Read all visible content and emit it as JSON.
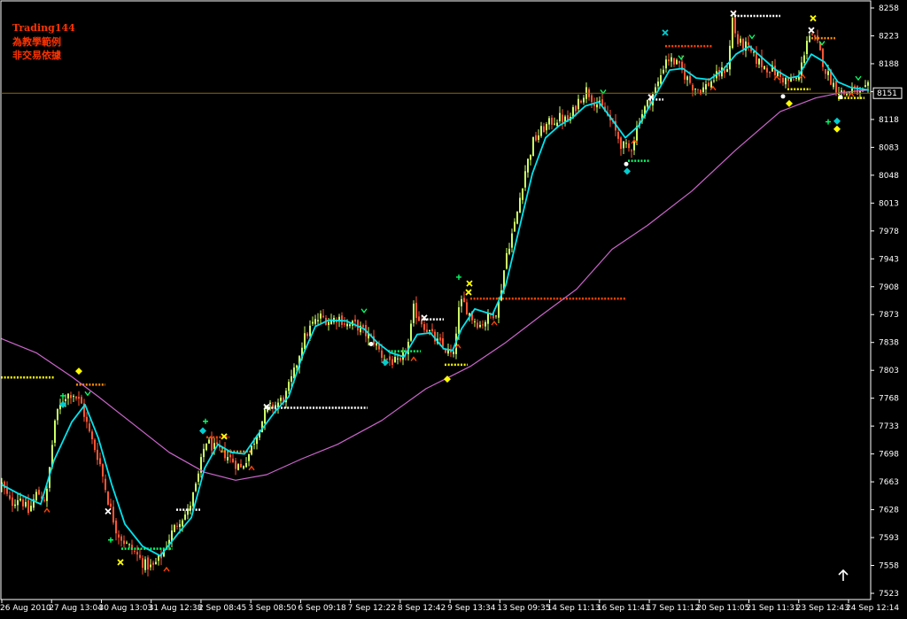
{
  "chart_data": {
    "type": "candlestick",
    "watermark": [
      "Trading144",
      "為教學範例",
      "非交易依據"
    ],
    "current_price": "8151",
    "ylim": [
      7505,
      8270
    ],
    "y_ticks": [
      "8258",
      "8223",
      "8188",
      "8153",
      "8118",
      "8083",
      "8048",
      "8013",
      "7978",
      "7943",
      "7908",
      "7873",
      "7838",
      "7803",
      "7768",
      "7733",
      "7698",
      "7663",
      "7628",
      "7593",
      "7558",
      "7523"
    ],
    "x_ticks": [
      "26 Aug 2010",
      "27 Aug 13:04",
      "30 Aug 13:03",
      "31 Aug 12:38",
      "2 Sep 08:45",
      "3 Sep 08:50",
      "6 Sep 09:18",
      "7 Sep 12:22",
      "8 Sep 12:42",
      "9 Sep 13:34",
      "13 Sep 09:35",
      "14 Sep 11:13",
      "16 Sep 11:41",
      "17 Sep 11:12",
      "20 Sep 11:05",
      "21 Sep 11:31",
      "23 Sep 12:43",
      "24 Sep 12:14"
    ],
    "price_path": [
      [
        0,
        7660
      ],
      [
        10,
        7635
      ],
      [
        20,
        7645
      ],
      [
        30,
        7625
      ],
      [
        40,
        7650
      ],
      [
        50,
        7640
      ],
      [
        60,
        7740
      ],
      [
        70,
        7770
      ],
      [
        80,
        7775
      ],
      [
        90,
        7760
      ],
      [
        100,
        7720
      ],
      [
        110,
        7690
      ],
      [
        120,
        7640
      ],
      [
        130,
        7600
      ],
      [
        140,
        7585
      ],
      [
        150,
        7575
      ],
      [
        160,
        7560
      ],
      [
        170,
        7555
      ],
      [
        180,
        7570
      ],
      [
        190,
        7595
      ],
      [
        200,
        7615
      ],
      [
        210,
        7625
      ],
      [
        220,
        7660
      ],
      [
        230,
        7715
      ],
      [
        240,
        7705
      ],
      [
        250,
        7700
      ],
      [
        260,
        7690
      ],
      [
        270,
        7680
      ],
      [
        280,
        7700
      ],
      [
        290,
        7730
      ],
      [
        300,
        7755
      ],
      [
        310,
        7760
      ],
      [
        320,
        7770
      ],
      [
        330,
        7800
      ],
      [
        340,
        7840
      ],
      [
        350,
        7860
      ],
      [
        360,
        7870
      ],
      [
        370,
        7865
      ],
      [
        380,
        7870
      ],
      [
        390,
        7860
      ],
      [
        400,
        7860
      ],
      [
        410,
        7850
      ],
      [
        420,
        7840
      ],
      [
        430,
        7820
      ],
      [
        440,
        7815
      ],
      [
        450,
        7810
      ],
      [
        460,
        7840
      ],
      [
        465,
        7880
      ],
      [
        470,
        7870
      ],
      [
        480,
        7855
      ],
      [
        490,
        7840
      ],
      [
        500,
        7830
      ],
      [
        510,
        7820
      ],
      [
        515,
        7875
      ],
      [
        520,
        7890
      ],
      [
        530,
        7870
      ],
      [
        540,
        7860
      ],
      [
        550,
        7870
      ],
      [
        560,
        7880
      ],
      [
        570,
        7950
      ],
      [
        580,
        7990
      ],
      [
        590,
        8050
      ],
      [
        600,
        8090
      ],
      [
        610,
        8105
      ],
      [
        620,
        8115
      ],
      [
        630,
        8120
      ],
      [
        640,
        8115
      ],
      [
        650,
        8140
      ],
      [
        660,
        8155
      ],
      [
        670,
        8140
      ],
      [
        680,
        8130
      ],
      [
        690,
        8110
      ],
      [
        700,
        8085
      ],
      [
        710,
        8080
      ],
      [
        720,
        8120
      ],
      [
        730,
        8140
      ],
      [
        740,
        8160
      ],
      [
        750,
        8195
      ],
      [
        760,
        8190
      ],
      [
        770,
        8175
      ],
      [
        780,
        8160
      ],
      [
        790,
        8155
      ],
      [
        800,
        8165
      ],
      [
        810,
        8175
      ],
      [
        820,
        8185
      ],
      [
        825,
        8245
      ],
      [
        830,
        8215
      ],
      [
        840,
        8210
      ],
      [
        850,
        8195
      ],
      [
        860,
        8185
      ],
      [
        870,
        8180
      ],
      [
        880,
        8170
      ],
      [
        890,
        8165
      ],
      [
        900,
        8170
      ],
      [
        910,
        8225
      ],
      [
        920,
        8215
      ],
      [
        930,
        8180
      ],
      [
        940,
        8160
      ],
      [
        950,
        8150
      ],
      [
        960,
        8155
      ],
      [
        970,
        8150
      ],
      [
        980,
        8160
      ]
    ],
    "ema_fast": [
      [
        0,
        7660
      ],
      [
        20,
        7648
      ],
      [
        45,
        7635
      ],
      [
        60,
        7690
      ],
      [
        80,
        7738
      ],
      [
        95,
        7760
      ],
      [
        110,
        7718
      ],
      [
        125,
        7660
      ],
      [
        140,
        7610
      ],
      [
        160,
        7582
      ],
      [
        180,
        7570
      ],
      [
        200,
        7598
      ],
      [
        215,
        7618
      ],
      [
        230,
        7680
      ],
      [
        245,
        7710
      ],
      [
        260,
        7700
      ],
      [
        275,
        7698
      ],
      [
        290,
        7722
      ],
      [
        310,
        7752
      ],
      [
        325,
        7770
      ],
      [
        340,
        7820
      ],
      [
        355,
        7858
      ],
      [
        370,
        7866
      ],
      [
        390,
        7865
      ],
      [
        410,
        7855
      ],
      [
        425,
        7838
      ],
      [
        440,
        7825
      ],
      [
        455,
        7820
      ],
      [
        470,
        7848
      ],
      [
        485,
        7850
      ],
      [
        500,
        7830
      ],
      [
        510,
        7828
      ],
      [
        520,
        7855
      ],
      [
        535,
        7880
      ],
      [
        555,
        7873
      ],
      [
        570,
        7910
      ],
      [
        585,
        7980
      ],
      [
        600,
        8050
      ],
      [
        615,
        8095
      ],
      [
        630,
        8110
      ],
      [
        645,
        8120
      ],
      [
        660,
        8135
      ],
      [
        675,
        8140
      ],
      [
        690,
        8118
      ],
      [
        705,
        8095
      ],
      [
        720,
        8110
      ],
      [
        740,
        8150
      ],
      [
        755,
        8180
      ],
      [
        770,
        8182
      ],
      [
        785,
        8170
      ],
      [
        800,
        8168
      ],
      [
        815,
        8180
      ],
      [
        830,
        8200
      ],
      [
        845,
        8210
      ],
      [
        860,
        8195
      ],
      [
        875,
        8180
      ],
      [
        890,
        8170
      ],
      [
        900,
        8172
      ],
      [
        915,
        8200
      ],
      [
        930,
        8190
      ],
      [
        945,
        8165
      ],
      [
        960,
        8158
      ],
      [
        980,
        8155
      ]
    ],
    "ema_slow": [
      [
        0,
        7843
      ],
      [
        40,
        7825
      ],
      [
        80,
        7795
      ],
      [
        110,
        7770
      ],
      [
        150,
        7735
      ],
      [
        190,
        7700
      ],
      [
        230,
        7675
      ],
      [
        265,
        7665
      ],
      [
        300,
        7672
      ],
      [
        340,
        7692
      ],
      [
        380,
        7710
      ],
      [
        430,
        7740
      ],
      [
        480,
        7780
      ],
      [
        530,
        7808
      ],
      [
        570,
        7838
      ],
      [
        610,
        7872
      ],
      [
        650,
        7905
      ],
      [
        690,
        7955
      ],
      [
        730,
        7985
      ],
      [
        780,
        8028
      ],
      [
        830,
        8080
      ],
      [
        880,
        8128
      ],
      [
        920,
        8145
      ],
      [
        950,
        8152
      ],
      [
        980,
        8155
      ]
    ],
    "levels": [
      {
        "color": "#ffff00",
        "x": [
          0,
          60
        ],
        "y": 7794
      },
      {
        "color": "#ff8c00",
        "x": [
          85,
          118
        ],
        "y": 7785
      },
      {
        "color": "#ffffff",
        "x": [
          298,
          414
        ],
        "y": 7756
      },
      {
        "color": "#ff8c00",
        "x": [
          248,
          282
        ],
        "y": 7701
      },
      {
        "color": "#ff4500",
        "x": [
          232,
          258
        ],
        "y": 7719
      },
      {
        "color": "#ffffff",
        "x": [
          198,
          225
        ],
        "y": 7628
      },
      {
        "color": "#00ff66",
        "x": [
          136,
          194
        ],
        "y": 7579
      },
      {
        "color": "#00ff66",
        "x": [
          437,
          474
        ],
        "y": 7827
      },
      {
        "color": "#ffff00",
        "x": [
          501,
          527
        ],
        "y": 7810
      },
      {
        "color": "#ff4500",
        "x": [
          530,
          705
        ],
        "y": 7893
      },
      {
        "color": "#ffffff",
        "x": [
          477,
          500
        ],
        "y": 7867
      },
      {
        "color": "#00ff66",
        "x": [
          708,
          732
        ],
        "y": 8066
      },
      {
        "color": "#ff4500",
        "x": [
          750,
          803
        ],
        "y": 8210
      },
      {
        "color": "#ffffff",
        "x": [
          828,
          880
        ],
        "y": 8248
      },
      {
        "color": "#ff8c00",
        "x": [
          915,
          942
        ],
        "y": 8220
      },
      {
        "color": "#ffff00",
        "x": [
          888,
          914
        ],
        "y": 8156
      },
      {
        "color": "#ffff00",
        "x": [
          945,
          975
        ],
        "y": 8145
      },
      {
        "color": "#ffffff",
        "x": [
          732,
          748
        ],
        "y": 8143
      }
    ],
    "markers": [
      {
        "sym": "diamond",
        "color": "#ffff00",
        "x": 88,
        "y": 7802
      },
      {
        "sym": "diamond",
        "color": "#00ced1",
        "x": 70,
        "y": 7760
      },
      {
        "sym": "plus",
        "color": "#00ff66",
        "x": 70,
        "y": 7771
      },
      {
        "sym": "v",
        "color": "#00ff66",
        "x": 98,
        "y": 7774
      },
      {
        "sym": "caret",
        "color": "#ff4500",
        "x": 52,
        "y": 7627
      },
      {
        "sym": "x",
        "color": "#ffffff",
        "x": 121,
        "y": 7626
      },
      {
        "sym": "plus",
        "color": "#00ff66",
        "x": 124,
        "y": 7590
      },
      {
        "sym": "x",
        "color": "#ffff00",
        "x": 135,
        "y": 7562
      },
      {
        "sym": "caret",
        "color": "#ff4500",
        "x": 187,
        "y": 7553
      },
      {
        "sym": "plus",
        "color": "#00ff66",
        "x": 231,
        "y": 7739
      },
      {
        "sym": "diamond",
        "color": "#00ced1",
        "x": 228,
        "y": 7727
      },
      {
        "sym": "x",
        "color": "#ffff00",
        "x": 252,
        "y": 7720
      },
      {
        "sym": "caret",
        "color": "#ff4500",
        "x": 283,
        "y": 7680
      },
      {
        "sym": "x",
        "color": "#ffffff",
        "x": 300,
        "y": 7757
      },
      {
        "sym": "v",
        "color": "#00ff66",
        "x": 410,
        "y": 7878
      },
      {
        "sym": "dot",
        "color": "#ffffff",
        "x": 418,
        "y": 7836
      },
      {
        "sym": "diamond",
        "color": "#00ced1",
        "x": 434,
        "y": 7813
      },
      {
        "sym": "caret",
        "color": "#ff4500",
        "x": 466,
        "y": 7817
      },
      {
        "sym": "x",
        "color": "#ffffff",
        "x": 478,
        "y": 7869
      },
      {
        "sym": "diamond",
        "color": "#ffff00",
        "x": 504,
        "y": 7792
      },
      {
        "sym": "caret",
        "color": "#ff4500",
        "x": 516,
        "y": 7833
      },
      {
        "sym": "plus",
        "color": "#00ff66",
        "x": 517,
        "y": 7920
      },
      {
        "sym": "x",
        "color": "#ffff00",
        "x": 529,
        "y": 7912
      },
      {
        "sym": "x",
        "color": "#ffff00",
        "x": 528,
        "y": 7901
      },
      {
        "sym": "caret",
        "color": "#ff4500",
        "x": 557,
        "y": 7862
      },
      {
        "sym": "v",
        "color": "#00ff66",
        "x": 680,
        "y": 8153
      },
      {
        "sym": "dot",
        "color": "#ffffff",
        "x": 706,
        "y": 8062
      },
      {
        "sym": "diamond",
        "color": "#00ced1",
        "x": 707,
        "y": 8053
      },
      {
        "sym": "caret",
        "color": "#ff4500",
        "x": 715,
        "y": 8090
      },
      {
        "sym": "x",
        "color": "#ffffff",
        "x": 734,
        "y": 8146
      },
      {
        "sym": "x",
        "color": "#00ced1",
        "x": 750,
        "y": 8227
      },
      {
        "sym": "v",
        "color": "#00ff66",
        "x": 768,
        "y": 8196
      },
      {
        "sym": "caret",
        "color": "#ff4500",
        "x": 804,
        "y": 8157
      },
      {
        "sym": "x",
        "color": "#ffffff",
        "x": 827,
        "y": 8251
      },
      {
        "sym": "v",
        "color": "#00ff66",
        "x": 848,
        "y": 8222
      },
      {
        "sym": "caret",
        "color": "#ff4500",
        "x": 876,
        "y": 8170
      },
      {
        "sym": "dot",
        "color": "#ffffff",
        "x": 883,
        "y": 8147
      },
      {
        "sym": "diamond",
        "color": "#ffff00",
        "x": 890,
        "y": 8138
      },
      {
        "sym": "caret",
        "color": "#ff4500",
        "x": 905,
        "y": 8172
      },
      {
        "sym": "x",
        "color": "#ffff00",
        "x": 917,
        "y": 8245
      },
      {
        "sym": "x",
        "color": "#ffffff",
        "x": 915,
        "y": 8230
      },
      {
        "sym": "v",
        "color": "#00ff66",
        "x": 927,
        "y": 8214
      },
      {
        "sym": "diamond",
        "color": "#00ced1",
        "x": 944,
        "y": 8116
      },
      {
        "sym": "diamond",
        "color": "#ffff00",
        "x": 944,
        "y": 8106
      },
      {
        "sym": "plus",
        "color": "#00ff66",
        "x": 934,
        "y": 8115
      },
      {
        "sym": "dot",
        "color": "#ffffff",
        "x": 948,
        "y": 8146
      },
      {
        "sym": "v",
        "color": "#00ff66",
        "x": 968,
        "y": 8170
      },
      {
        "sym": "caret",
        "color": "#ff4500",
        "x": 960,
        "y": 8149
      }
    ]
  },
  "colors": {
    "background": "#000000",
    "frame": "#ffffff",
    "bull": "#ccff66",
    "bear": "#ff5533",
    "ema_fast": "#00e5ee",
    "ema_slow": "#cc66cc",
    "price_line": "#8b6914",
    "watermark": "#ff3300",
    "text": "#ffffff"
  },
  "icons": {
    "arrow": "up-arrow-icon"
  }
}
